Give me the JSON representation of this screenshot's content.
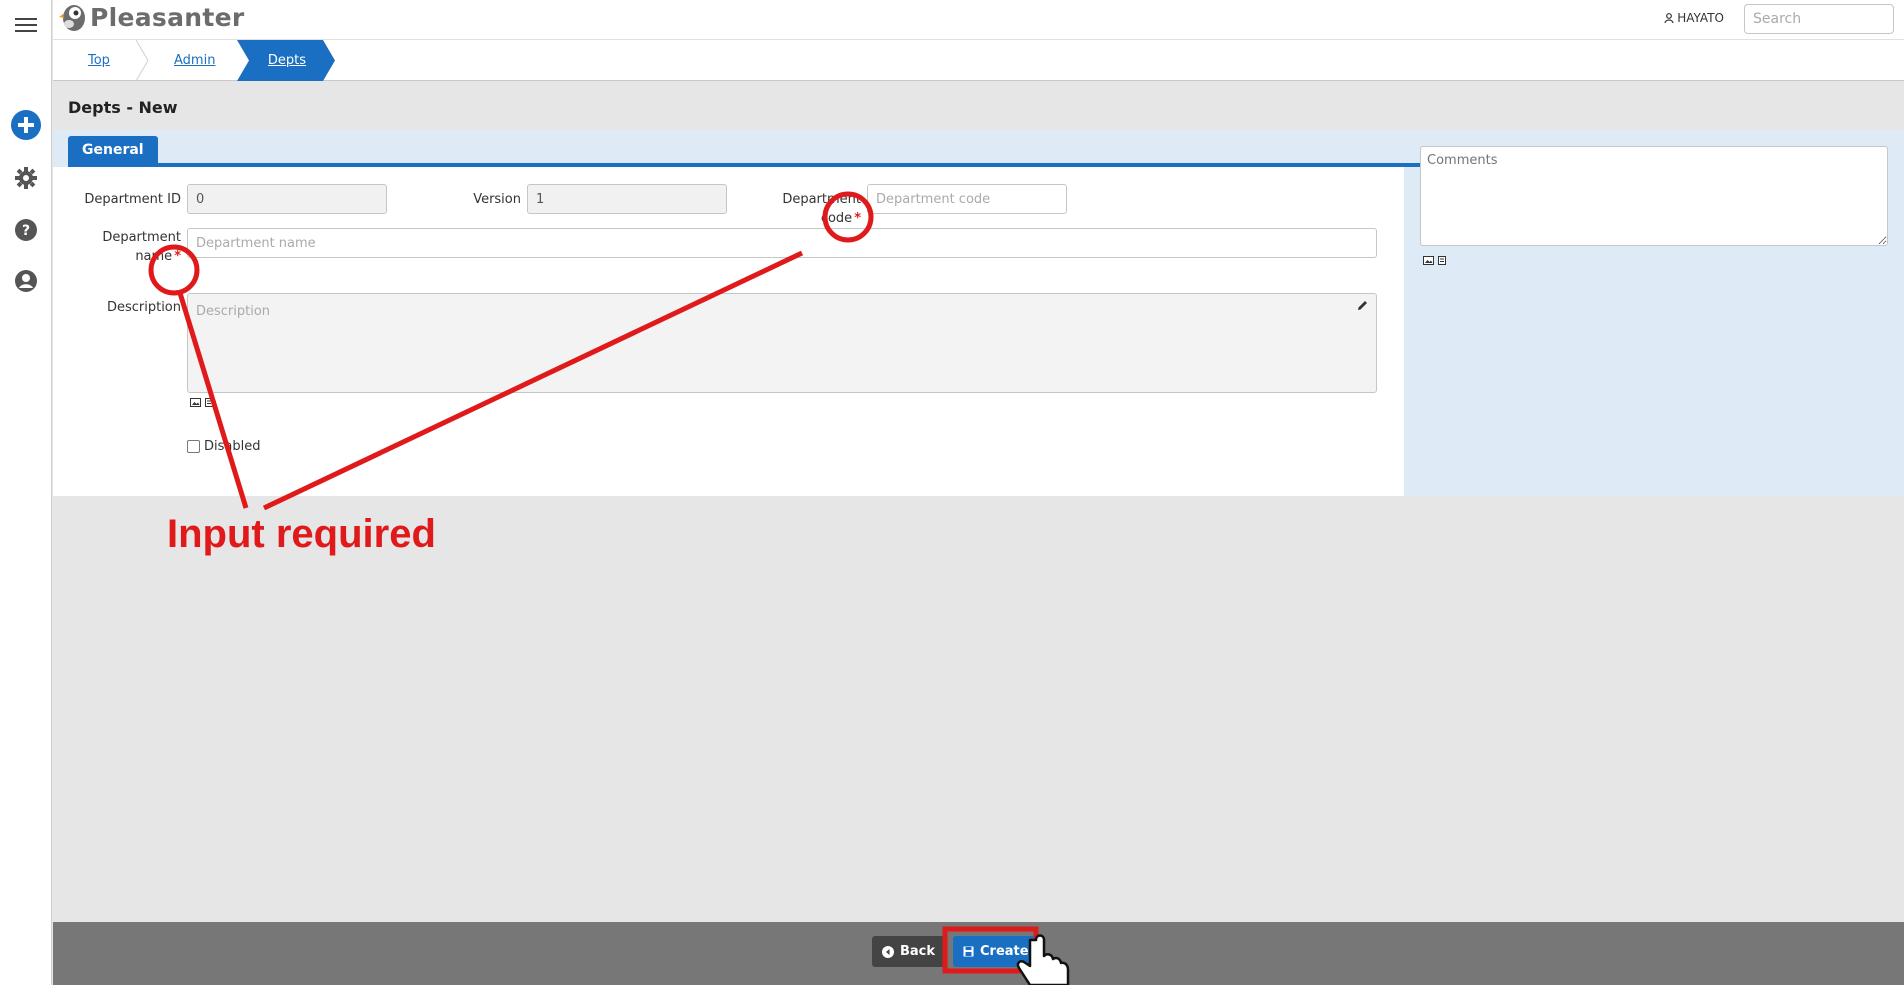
{
  "app": {
    "logo_text": "Pleasanter",
    "user_name": "HAYATO",
    "search_placeholder": "Search"
  },
  "nav_icons": [
    "menu-icon",
    "plus-circle-icon",
    "gear-icon",
    "help-icon",
    "user-icon"
  ],
  "breadcrumb": {
    "items": [
      "Top",
      "Admin",
      "Depts"
    ]
  },
  "page": {
    "title": "Depts - New",
    "tab_general": "General"
  },
  "form": {
    "dept_id_label": "Department ID",
    "dept_id_value": "0",
    "version_label": "Version",
    "version_value": "1",
    "dept_code_label_1": "Department",
    "dept_code_label_2": "code",
    "dept_code_placeholder": "Department code",
    "dept_name_label_1": "Department",
    "dept_name_label_2": "name",
    "dept_name_placeholder": "Department name",
    "description_label": "Description",
    "description_placeholder": "Description",
    "disabled_label": "Disabled",
    "comments_placeholder": "Comments",
    "required_mark": "*"
  },
  "footer": {
    "back_label": "Back",
    "create_label": "Create"
  },
  "annotation": {
    "text": "Input required",
    "color": "#e01a1a"
  },
  "colors": {
    "accent": "#1a6fc2",
    "panel_bg": "#dfeaf7",
    "footer_bg": "#777777"
  }
}
